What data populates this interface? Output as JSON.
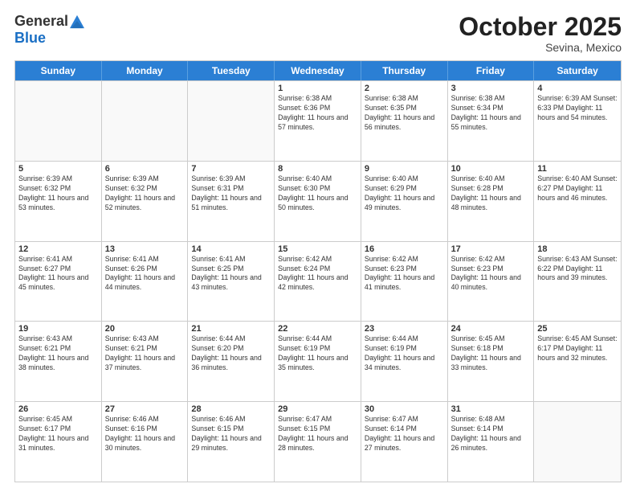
{
  "logo": {
    "general": "General",
    "blue": "Blue"
  },
  "title": "October 2025",
  "location": "Sevina, Mexico",
  "days_of_week": [
    "Sunday",
    "Monday",
    "Tuesday",
    "Wednesday",
    "Thursday",
    "Friday",
    "Saturday"
  ],
  "weeks": [
    [
      {
        "day": "",
        "info": ""
      },
      {
        "day": "",
        "info": ""
      },
      {
        "day": "",
        "info": ""
      },
      {
        "day": "1",
        "info": "Sunrise: 6:38 AM\nSunset: 6:36 PM\nDaylight: 11 hours and 57 minutes."
      },
      {
        "day": "2",
        "info": "Sunrise: 6:38 AM\nSunset: 6:35 PM\nDaylight: 11 hours and 56 minutes."
      },
      {
        "day": "3",
        "info": "Sunrise: 6:38 AM\nSunset: 6:34 PM\nDaylight: 11 hours and 55 minutes."
      },
      {
        "day": "4",
        "info": "Sunrise: 6:39 AM\nSunset: 6:33 PM\nDaylight: 11 hours and 54 minutes."
      }
    ],
    [
      {
        "day": "5",
        "info": "Sunrise: 6:39 AM\nSunset: 6:32 PM\nDaylight: 11 hours and 53 minutes."
      },
      {
        "day": "6",
        "info": "Sunrise: 6:39 AM\nSunset: 6:32 PM\nDaylight: 11 hours and 52 minutes."
      },
      {
        "day": "7",
        "info": "Sunrise: 6:39 AM\nSunset: 6:31 PM\nDaylight: 11 hours and 51 minutes."
      },
      {
        "day": "8",
        "info": "Sunrise: 6:40 AM\nSunset: 6:30 PM\nDaylight: 11 hours and 50 minutes."
      },
      {
        "day": "9",
        "info": "Sunrise: 6:40 AM\nSunset: 6:29 PM\nDaylight: 11 hours and 49 minutes."
      },
      {
        "day": "10",
        "info": "Sunrise: 6:40 AM\nSunset: 6:28 PM\nDaylight: 11 hours and 48 minutes."
      },
      {
        "day": "11",
        "info": "Sunrise: 6:40 AM\nSunset: 6:27 PM\nDaylight: 11 hours and 46 minutes."
      }
    ],
    [
      {
        "day": "12",
        "info": "Sunrise: 6:41 AM\nSunset: 6:27 PM\nDaylight: 11 hours and 45 minutes."
      },
      {
        "day": "13",
        "info": "Sunrise: 6:41 AM\nSunset: 6:26 PM\nDaylight: 11 hours and 44 minutes."
      },
      {
        "day": "14",
        "info": "Sunrise: 6:41 AM\nSunset: 6:25 PM\nDaylight: 11 hours and 43 minutes."
      },
      {
        "day": "15",
        "info": "Sunrise: 6:42 AM\nSunset: 6:24 PM\nDaylight: 11 hours and 42 minutes."
      },
      {
        "day": "16",
        "info": "Sunrise: 6:42 AM\nSunset: 6:23 PM\nDaylight: 11 hours and 41 minutes."
      },
      {
        "day": "17",
        "info": "Sunrise: 6:42 AM\nSunset: 6:23 PM\nDaylight: 11 hours and 40 minutes."
      },
      {
        "day": "18",
        "info": "Sunrise: 6:43 AM\nSunset: 6:22 PM\nDaylight: 11 hours and 39 minutes."
      }
    ],
    [
      {
        "day": "19",
        "info": "Sunrise: 6:43 AM\nSunset: 6:21 PM\nDaylight: 11 hours and 38 minutes."
      },
      {
        "day": "20",
        "info": "Sunrise: 6:43 AM\nSunset: 6:21 PM\nDaylight: 11 hours and 37 minutes."
      },
      {
        "day": "21",
        "info": "Sunrise: 6:44 AM\nSunset: 6:20 PM\nDaylight: 11 hours and 36 minutes."
      },
      {
        "day": "22",
        "info": "Sunrise: 6:44 AM\nSunset: 6:19 PM\nDaylight: 11 hours and 35 minutes."
      },
      {
        "day": "23",
        "info": "Sunrise: 6:44 AM\nSunset: 6:19 PM\nDaylight: 11 hours and 34 minutes."
      },
      {
        "day": "24",
        "info": "Sunrise: 6:45 AM\nSunset: 6:18 PM\nDaylight: 11 hours and 33 minutes."
      },
      {
        "day": "25",
        "info": "Sunrise: 6:45 AM\nSunset: 6:17 PM\nDaylight: 11 hours and 32 minutes."
      }
    ],
    [
      {
        "day": "26",
        "info": "Sunrise: 6:45 AM\nSunset: 6:17 PM\nDaylight: 11 hours and 31 minutes."
      },
      {
        "day": "27",
        "info": "Sunrise: 6:46 AM\nSunset: 6:16 PM\nDaylight: 11 hours and 30 minutes."
      },
      {
        "day": "28",
        "info": "Sunrise: 6:46 AM\nSunset: 6:15 PM\nDaylight: 11 hours and 29 minutes."
      },
      {
        "day": "29",
        "info": "Sunrise: 6:47 AM\nSunset: 6:15 PM\nDaylight: 11 hours and 28 minutes."
      },
      {
        "day": "30",
        "info": "Sunrise: 6:47 AM\nSunset: 6:14 PM\nDaylight: 11 hours and 27 minutes."
      },
      {
        "day": "31",
        "info": "Sunrise: 6:48 AM\nSunset: 6:14 PM\nDaylight: 11 hours and 26 minutes."
      },
      {
        "day": "",
        "info": ""
      }
    ]
  ]
}
